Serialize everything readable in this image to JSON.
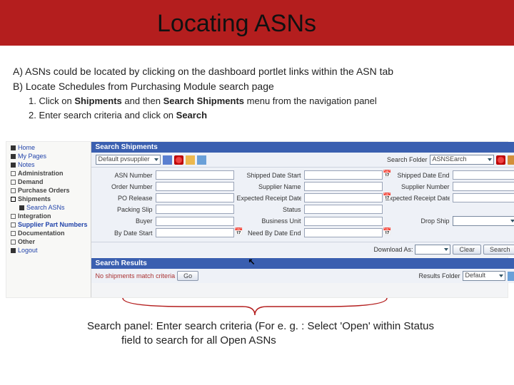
{
  "title": "Locating ASNs",
  "lineA": "A) ASNs could be located by clicking on the dashboard portlet links within the ASN tab",
  "lineB": "B) Locate Schedules from Purchasing Module search page",
  "step1_pre": "1. Click on ",
  "step1_boldA": "Shipments",
  "step1_mid": " and then ",
  "step1_boldB": "Search Shipments",
  "step1_post": " menu from the navigation panel",
  "step2_pre": "2. Enter search criteria and click on ",
  "step2_bold": "Search",
  "nav": {
    "home": "Home",
    "mypages": "My Pages",
    "notes": "Notes",
    "admin": "Administration",
    "demand": "Demand",
    "po": "Purchase Orders",
    "ship": "Shipments",
    "search_asn": "Search ASNs",
    "integ": "Integration",
    "spn": "Supplier Part Numbers",
    "doc": "Documentation",
    "other": "Other",
    "logout": "Logout"
  },
  "sections": {
    "search_ship": "Search Shipments",
    "search_results": "Search Results"
  },
  "toolbar": {
    "default_sel": "Default pvsupplier",
    "search_folder_lbl": "Search Folder",
    "search_folder_val": "ASNSEarch"
  },
  "fields": {
    "asn_no": "ASN Number",
    "ship_start": "Shipped Date Start",
    "ship_end": "Shipped Date End",
    "order_no": "Order Number",
    "sup_name": "Supplier Name",
    "sup_no": "Supplier Number",
    "po_rel": "PO Release",
    "exp_start": "Expected Receipt Date Start",
    "exp_end": "Expected Receipt Date End",
    "pack_slip": "Packing Slip",
    "status": "Status",
    "buyer": "Buyer",
    "bu": "Business Unit",
    "drop": "Drop Ship",
    "by_start": "By Date Start",
    "need_end": "Need By Date End"
  },
  "buttons": {
    "download_as": "Download As:",
    "clear": "Clear",
    "search": "Search",
    "go": "Go"
  },
  "results": {
    "none": "No shipments match criteria",
    "results_folder_lbl": "Results Folder",
    "results_folder_val": "Default"
  },
  "caption_line1": "Search panel: Enter search criteria (For e. g. : Select 'Open' within Status",
  "caption_line2": "field to search for all Open ASNs"
}
